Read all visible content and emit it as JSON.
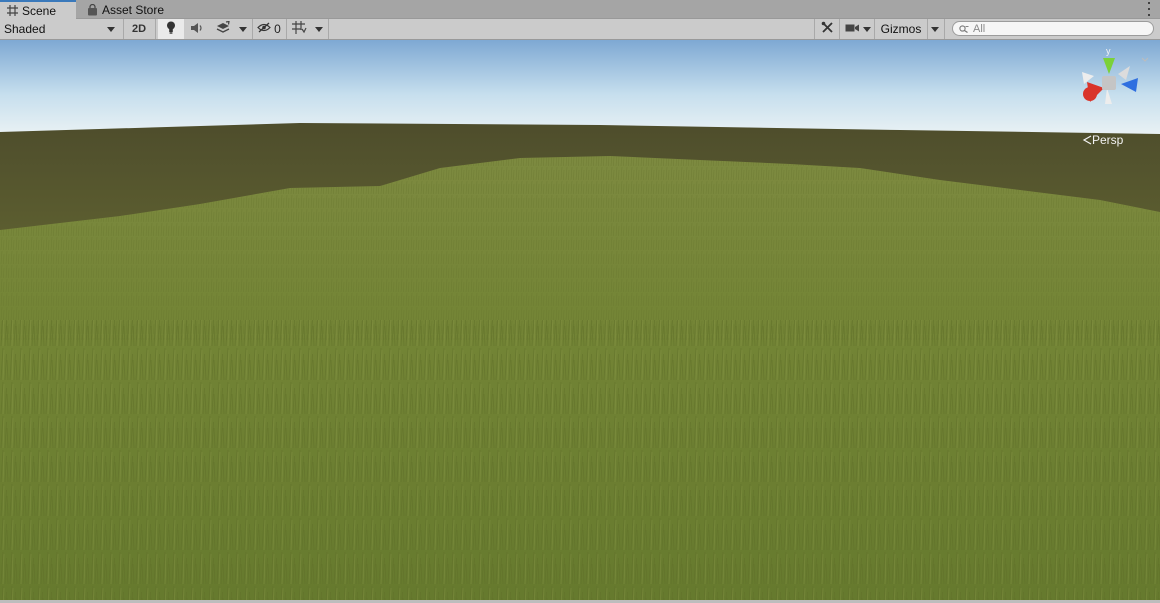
{
  "tabs": [
    {
      "label": "Scene",
      "icon": "hash-grid-icon",
      "active": true
    },
    {
      "label": "Asset Store",
      "icon": "shopping-bag-icon",
      "active": false
    }
  ],
  "toolbar": {
    "draw_mode": "Shaded",
    "toggle_2d": "2D",
    "lighting_icon": "lightbulb-icon",
    "audio_icon": "speaker-icon",
    "effects_icon": "layers-icon",
    "hidden_count": "0",
    "grid_icon": "grid-snap-icon",
    "tools_icon": "wrench-cross-icon",
    "camera_icon": "camera-icon",
    "gizmos_label": "Gizmos",
    "search_placeholder": "All"
  },
  "scene": {
    "projection_label": "Persp",
    "axis_y": "y",
    "colors": {
      "sky_top": "#7fa9d4",
      "sky_horizon": "#e9f2f7",
      "far_ground": "#54532d",
      "grass_light": "#7d8c3c",
      "grass_dark": "#5e6b2a"
    }
  }
}
